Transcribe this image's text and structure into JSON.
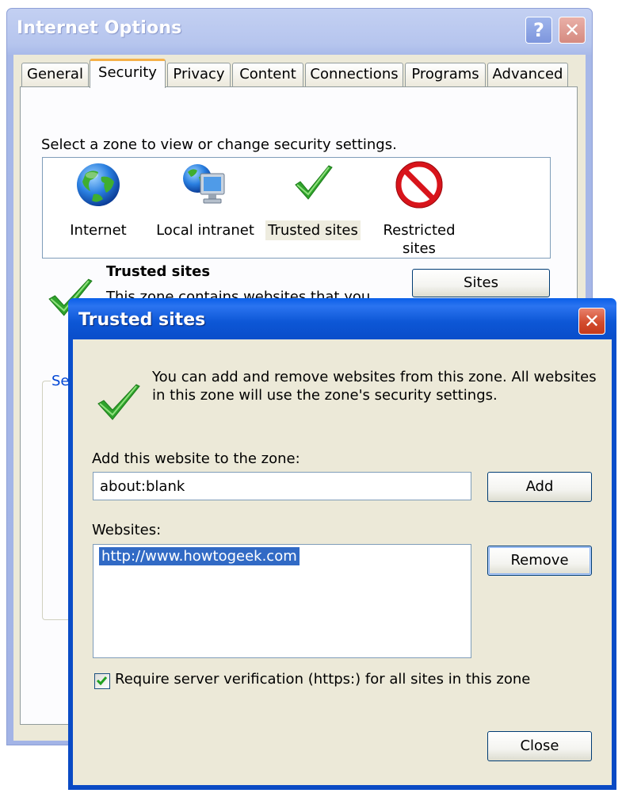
{
  "internet_options": {
    "title": "Internet Options",
    "help_glyph": "?",
    "close_glyph": "✕",
    "tabs": [
      {
        "label": "General"
      },
      {
        "label": "Security"
      },
      {
        "label": "Privacy"
      },
      {
        "label": "Content"
      },
      {
        "label": "Connections"
      },
      {
        "label": "Programs"
      },
      {
        "label": "Advanced"
      }
    ],
    "active_tab": "Security",
    "zone_instruction": "Select a zone to view or change security settings.",
    "zones": [
      {
        "label": "Internet",
        "icon": "globe-icon"
      },
      {
        "label": "Local intranet",
        "icon": "intranet-icon"
      },
      {
        "label": "Trusted sites",
        "icon": "checkmark-icon"
      },
      {
        "label": "Restricted sites",
        "icon": "restricted-icon"
      }
    ],
    "selected_zone": "Trusted sites",
    "zone_heading": "Trusted sites",
    "zone_description": "This zone contains websites that you",
    "sites_button": "Sites",
    "security_group_legend": "Se"
  },
  "trusted_sites": {
    "title": "Trusted sites",
    "close_glyph": "✕",
    "intro": "You can add and remove websites from this zone. All websites in this zone will use the zone's security settings.",
    "add_label": "Add this website to the zone:",
    "add_value": "about:blank",
    "add_button": "Add",
    "websites_label": "Websites:",
    "websites": [
      "http://www.howtogeek.com"
    ],
    "remove_button": "Remove",
    "https_label": "Require server verification (https:) for all sites in this zone",
    "https_checked": true,
    "close_button": "Close"
  },
  "colors": {
    "xp_title_blue": "#0a4fcc",
    "dialog_face": "#ece9d8",
    "selection_blue": "#316ac5",
    "check_green": "#2fa32c",
    "restricted_red": "#d8141b"
  }
}
